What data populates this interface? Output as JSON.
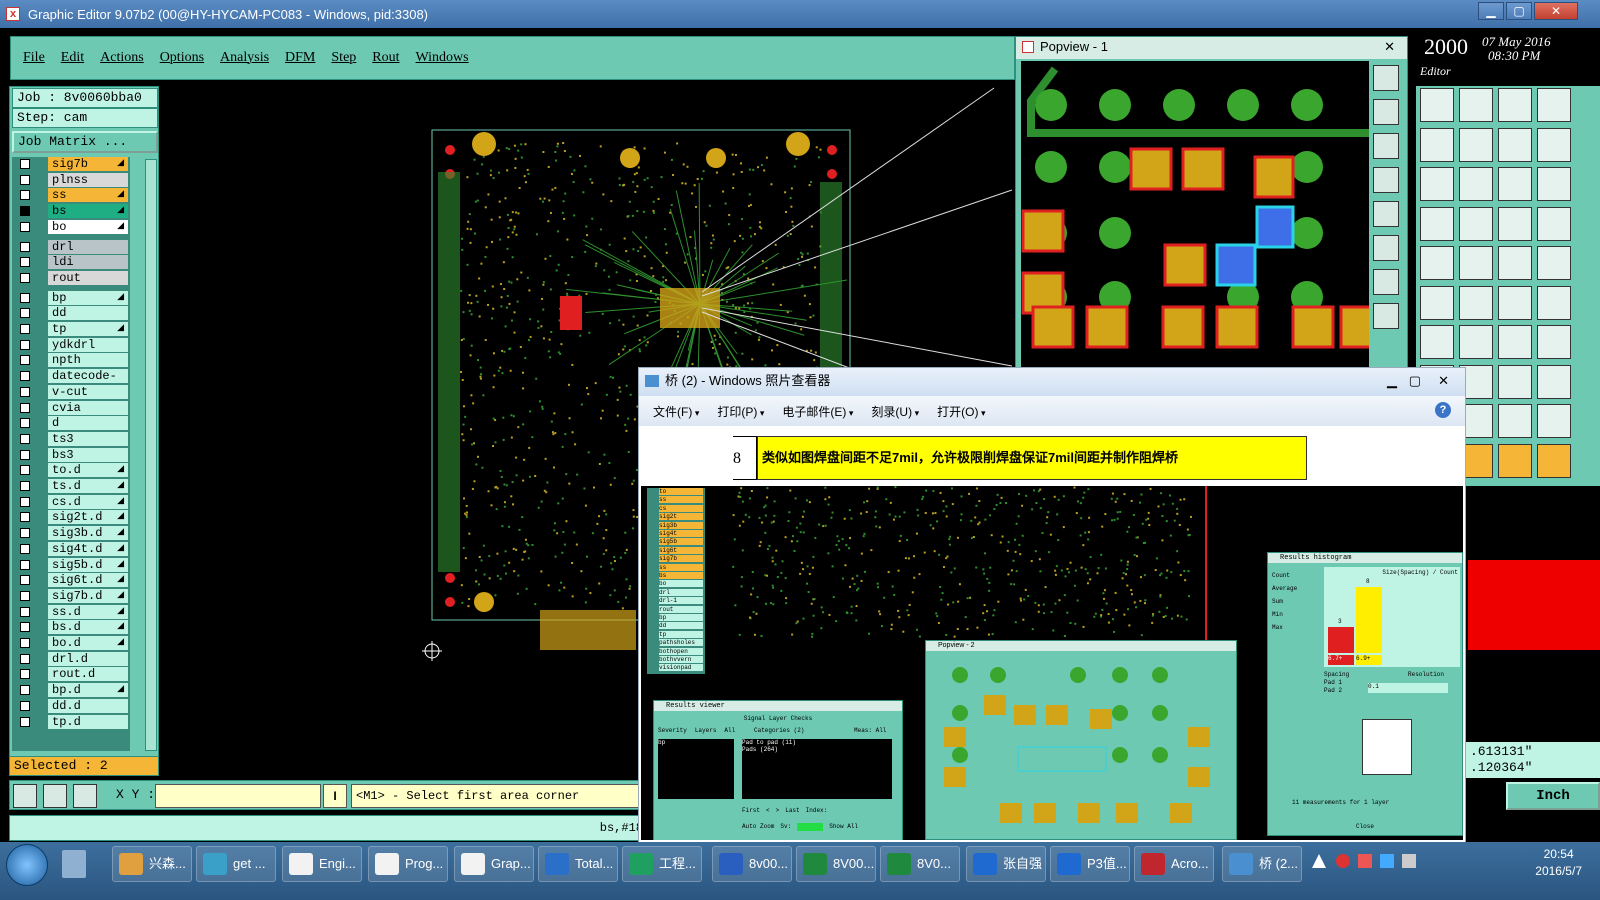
{
  "app": {
    "title": "Graphic Editor 9.07b2 (00@HY-HYCAM-PC083 - Windows, pid:3308)",
    "controls": {
      "minimize": "▁",
      "maximize": "▢",
      "close": "✕"
    }
  },
  "menu": [
    "File",
    "Edit",
    "Actions",
    "Options",
    "Analysis",
    "DFM",
    "Step",
    "Rout",
    "Windows"
  ],
  "job": {
    "job": "Job : 8v0060bba0",
    "step": "Step: cam",
    "matrix": "Job Matrix ..."
  },
  "layers": [
    {
      "name": "sig7b",
      "color": "#f5b638",
      "edit": true,
      "checked": false
    },
    {
      "name": "plnss",
      "color": "#d8d8d8",
      "edit": false,
      "checked": false
    },
    {
      "name": "ss",
      "color": "#f5b638",
      "edit": true,
      "checked": false
    },
    {
      "name": "bs",
      "color": "#1fae84",
      "edit": true,
      "checked": true
    },
    {
      "name": "bo",
      "color": "#ffffff",
      "edit": true,
      "checked": false
    },
    {
      "name": "drl",
      "color": "#b9c4c8",
      "edit": false,
      "checked": false
    },
    {
      "name": "ldi",
      "color": "#b9c4c8",
      "edit": false,
      "checked": false
    },
    {
      "name": "rout",
      "color": "#d8d8d8",
      "edit": false,
      "checked": false
    },
    {
      "name": "bp",
      "color": "#bff3e4",
      "edit": true,
      "checked": false
    },
    {
      "name": "dd",
      "color": "#bff3e4",
      "edit": false,
      "checked": false
    },
    {
      "name": "tp",
      "color": "#bff3e4",
      "edit": true,
      "checked": false
    },
    {
      "name": "ydkdrl",
      "color": "#bff3e4",
      "edit": false,
      "checked": false
    },
    {
      "name": "npth",
      "color": "#bff3e4",
      "edit": false,
      "checked": false
    },
    {
      "name": "datecode-ss",
      "color": "#bff3e4",
      "edit": false,
      "checked": false
    },
    {
      "name": "v-cut",
      "color": "#bff3e4",
      "edit": false,
      "checked": false
    },
    {
      "name": "cvia",
      "color": "#bff3e4",
      "edit": false,
      "checked": false
    },
    {
      "name": "d",
      "color": "#bff3e4",
      "edit": false,
      "checked": false
    },
    {
      "name": "ts3",
      "color": "#bff3e4",
      "edit": false,
      "checked": false
    },
    {
      "name": "bs3",
      "color": "#bff3e4",
      "edit": false,
      "checked": false
    },
    {
      "name": "to.d",
      "color": "#bff3e4",
      "edit": true,
      "checked": false
    },
    {
      "name": "ts.d",
      "color": "#bff3e4",
      "edit": true,
      "checked": false
    },
    {
      "name": "cs.d",
      "color": "#bff3e4",
      "edit": true,
      "checked": false
    },
    {
      "name": "sig2t.d",
      "color": "#bff3e4",
      "edit": true,
      "checked": false
    },
    {
      "name": "sig3b.d",
      "color": "#bff3e4",
      "edit": true,
      "checked": false
    },
    {
      "name": "sig4t.d",
      "color": "#bff3e4",
      "edit": true,
      "checked": false
    },
    {
      "name": "sig5b.d",
      "color": "#bff3e4",
      "edit": true,
      "checked": false
    },
    {
      "name": "sig6t.d",
      "color": "#bff3e4",
      "edit": true,
      "checked": false
    },
    {
      "name": "sig7b.d",
      "color": "#bff3e4",
      "edit": true,
      "checked": false
    },
    {
      "name": "ss.d",
      "color": "#bff3e4",
      "edit": true,
      "checked": false
    },
    {
      "name": "bs.d",
      "color": "#bff3e4",
      "edit": true,
      "checked": false
    },
    {
      "name": "bo.d",
      "color": "#bff3e4",
      "edit": true,
      "checked": false
    },
    {
      "name": "drl.d",
      "color": "#bff3e4",
      "edit": false,
      "checked": false
    },
    {
      "name": "rout.d",
      "color": "#bff3e4",
      "edit": false,
      "checked": false
    },
    {
      "name": "bp.d",
      "color": "#bff3e4",
      "edit": true,
      "checked": false
    },
    {
      "name": "dd.d",
      "color": "#bff3e4",
      "edit": false,
      "checked": false
    },
    {
      "name": "tp.d",
      "color": "#bff3e4",
      "edit": false,
      "checked": false
    }
  ],
  "selected": "Selected : 2",
  "coords": {
    "label": "X Y :",
    "value": "",
    "info_button": "I"
  },
  "prompt": "<M1> - Select first area corner",
  "status": "bs,#18",
  "units": "Inch",
  "readout": {
    "x": ".613131\"",
    "y": ".120364\""
  },
  "datetime": {
    "year": "2000",
    "date": "07 May 2016",
    "time": "08:30 PM",
    "editor": "Editor"
  },
  "popview": {
    "title": "Popview - 1",
    "close": "✕"
  },
  "photo_viewer": {
    "title": "桥 (2) - Windows 照片查看器",
    "menu": [
      "文件(F)",
      "打印(P)",
      "电子邮件(E)",
      "刻录(U)",
      "打开(O)"
    ],
    "help": "?",
    "item_number": "8",
    "note": "类似如图焊盘间距不足7mil，允许极限削焊盘保证7mil间距并制作阻焊桥"
  },
  "embedded": {
    "results_viewer": {
      "title": "Results viewer",
      "header": "Signal Layer Checks",
      "cols": [
        "Severity",
        "Layers",
        "All"
      ],
      "categories": "Categories (2)",
      "meas": "Meas: All",
      "layer": "bp",
      "items": [
        "Pad to pad (11)",
        "Pads (264)"
      ],
      "nav": [
        "First",
        "<",
        ">",
        "Last"
      ],
      "index": "Index:",
      "auto_zoom": "Auto Zoom",
      "sv": "Sv:",
      "show_all": "Show All"
    },
    "histogram": {
      "title": "Results histogram",
      "options": [
        "Count",
        "Average",
        "Sum",
        "Min",
        "Max"
      ],
      "chart_title": "Size(Spacing) / Count",
      "bar_labels": [
        "3",
        "8"
      ],
      "x_labels": [
        "6.7+",
        "6.9+"
      ],
      "spacing": [
        "Spacing",
        "Pad 1",
        "Pad 2"
      ],
      "resolution_label": "Resolution",
      "resolution": "0.1",
      "summary": "11 measurements for 1 layer",
      "close": "Close"
    },
    "popview2": {
      "title": "Popview - 2"
    },
    "layers": [
      "to",
      "ss",
      "cs",
      "sig2t",
      "sig3b",
      "sig4t",
      "sig5b",
      "sig6t",
      "sig7b",
      "ss",
      "bs",
      "bo",
      "drl",
      "drl-1",
      "rout",
      "bp",
      "dd",
      "tp",
      "pathsholes",
      "bothopen",
      "bothvvern",
      "visionpad"
    ]
  },
  "taskbar": {
    "tasks": [
      {
        "label": "兴森...",
        "color": "#e0a040"
      },
      {
        "label": "get ...",
        "color": "#3aa0c8"
      },
      {
        "label": "Engi...",
        "color": "#f2f2f2"
      },
      {
        "label": "Prog...",
        "color": "#f2f2f2"
      },
      {
        "label": "Grap...",
        "color": "#f2f2f2"
      },
      {
        "label": "Total...",
        "color": "#2a6fc8"
      },
      {
        "label": "工程...",
        "color": "#20a060"
      },
      {
        "label": "8v00...",
        "color": "#2a5fbf"
      },
      {
        "label": "8V00...",
        "color": "#1f8a3e"
      },
      {
        "label": "8V0...",
        "color": "#1f8a3e"
      },
      {
        "label": "张自强",
        "color": "#1e6ad0"
      },
      {
        "label": "P3值...",
        "color": "#1e6ad0"
      },
      {
        "label": "Acro...",
        "color": "#c0262d"
      },
      {
        "label": "桥 (2...",
        "color": "#4a8fd0"
      }
    ],
    "time": "20:54",
    "date": "2016/5/7"
  }
}
